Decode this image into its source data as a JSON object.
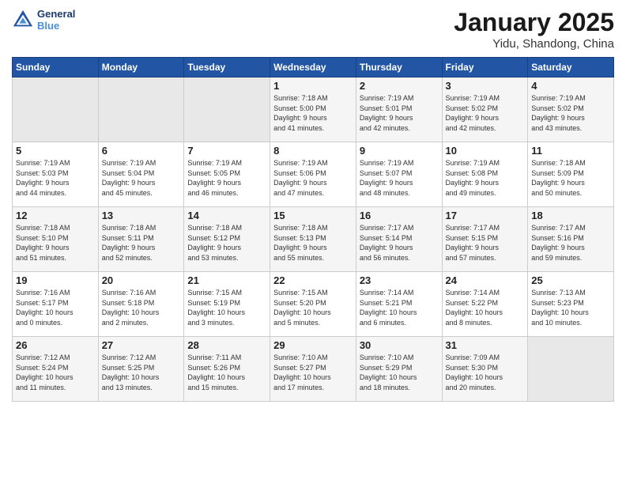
{
  "logo": {
    "line1": "General",
    "line2": "Blue"
  },
  "calendar": {
    "title": "January 2025",
    "subtitle": "Yidu, Shandong, China",
    "days_header": [
      "Sunday",
      "Monday",
      "Tuesday",
      "Wednesday",
      "Thursday",
      "Friday",
      "Saturday"
    ]
  },
  "weeks": [
    [
      {
        "day": "",
        "info": ""
      },
      {
        "day": "",
        "info": ""
      },
      {
        "day": "",
        "info": ""
      },
      {
        "day": "1",
        "info": "Sunrise: 7:18 AM\nSunset: 5:00 PM\nDaylight: 9 hours\nand 41 minutes."
      },
      {
        "day": "2",
        "info": "Sunrise: 7:19 AM\nSunset: 5:01 PM\nDaylight: 9 hours\nand 42 minutes."
      },
      {
        "day": "3",
        "info": "Sunrise: 7:19 AM\nSunset: 5:02 PM\nDaylight: 9 hours\nand 42 minutes."
      },
      {
        "day": "4",
        "info": "Sunrise: 7:19 AM\nSunset: 5:02 PM\nDaylight: 9 hours\nand 43 minutes."
      }
    ],
    [
      {
        "day": "5",
        "info": "Sunrise: 7:19 AM\nSunset: 5:03 PM\nDaylight: 9 hours\nand 44 minutes."
      },
      {
        "day": "6",
        "info": "Sunrise: 7:19 AM\nSunset: 5:04 PM\nDaylight: 9 hours\nand 45 minutes."
      },
      {
        "day": "7",
        "info": "Sunrise: 7:19 AM\nSunset: 5:05 PM\nDaylight: 9 hours\nand 46 minutes."
      },
      {
        "day": "8",
        "info": "Sunrise: 7:19 AM\nSunset: 5:06 PM\nDaylight: 9 hours\nand 47 minutes."
      },
      {
        "day": "9",
        "info": "Sunrise: 7:19 AM\nSunset: 5:07 PM\nDaylight: 9 hours\nand 48 minutes."
      },
      {
        "day": "10",
        "info": "Sunrise: 7:19 AM\nSunset: 5:08 PM\nDaylight: 9 hours\nand 49 minutes."
      },
      {
        "day": "11",
        "info": "Sunrise: 7:18 AM\nSunset: 5:09 PM\nDaylight: 9 hours\nand 50 minutes."
      }
    ],
    [
      {
        "day": "12",
        "info": "Sunrise: 7:18 AM\nSunset: 5:10 PM\nDaylight: 9 hours\nand 51 minutes."
      },
      {
        "day": "13",
        "info": "Sunrise: 7:18 AM\nSunset: 5:11 PM\nDaylight: 9 hours\nand 52 minutes."
      },
      {
        "day": "14",
        "info": "Sunrise: 7:18 AM\nSunset: 5:12 PM\nDaylight: 9 hours\nand 53 minutes."
      },
      {
        "day": "15",
        "info": "Sunrise: 7:18 AM\nSunset: 5:13 PM\nDaylight: 9 hours\nand 55 minutes."
      },
      {
        "day": "16",
        "info": "Sunrise: 7:17 AM\nSunset: 5:14 PM\nDaylight: 9 hours\nand 56 minutes."
      },
      {
        "day": "17",
        "info": "Sunrise: 7:17 AM\nSunset: 5:15 PM\nDaylight: 9 hours\nand 57 minutes."
      },
      {
        "day": "18",
        "info": "Sunrise: 7:17 AM\nSunset: 5:16 PM\nDaylight: 9 hours\nand 59 minutes."
      }
    ],
    [
      {
        "day": "19",
        "info": "Sunrise: 7:16 AM\nSunset: 5:17 PM\nDaylight: 10 hours\nand 0 minutes."
      },
      {
        "day": "20",
        "info": "Sunrise: 7:16 AM\nSunset: 5:18 PM\nDaylight: 10 hours\nand 2 minutes."
      },
      {
        "day": "21",
        "info": "Sunrise: 7:15 AM\nSunset: 5:19 PM\nDaylight: 10 hours\nand 3 minutes."
      },
      {
        "day": "22",
        "info": "Sunrise: 7:15 AM\nSunset: 5:20 PM\nDaylight: 10 hours\nand 5 minutes."
      },
      {
        "day": "23",
        "info": "Sunrise: 7:14 AM\nSunset: 5:21 PM\nDaylight: 10 hours\nand 6 minutes."
      },
      {
        "day": "24",
        "info": "Sunrise: 7:14 AM\nSunset: 5:22 PM\nDaylight: 10 hours\nand 8 minutes."
      },
      {
        "day": "25",
        "info": "Sunrise: 7:13 AM\nSunset: 5:23 PM\nDaylight: 10 hours\nand 10 minutes."
      }
    ],
    [
      {
        "day": "26",
        "info": "Sunrise: 7:12 AM\nSunset: 5:24 PM\nDaylight: 10 hours\nand 11 minutes."
      },
      {
        "day": "27",
        "info": "Sunrise: 7:12 AM\nSunset: 5:25 PM\nDaylight: 10 hours\nand 13 minutes."
      },
      {
        "day": "28",
        "info": "Sunrise: 7:11 AM\nSunset: 5:26 PM\nDaylight: 10 hours\nand 15 minutes."
      },
      {
        "day": "29",
        "info": "Sunrise: 7:10 AM\nSunset: 5:27 PM\nDaylight: 10 hours\nand 17 minutes."
      },
      {
        "day": "30",
        "info": "Sunrise: 7:10 AM\nSunset: 5:29 PM\nDaylight: 10 hours\nand 18 minutes."
      },
      {
        "day": "31",
        "info": "Sunrise: 7:09 AM\nSunset: 5:30 PM\nDaylight: 10 hours\nand 20 minutes."
      },
      {
        "day": "",
        "info": ""
      }
    ]
  ]
}
